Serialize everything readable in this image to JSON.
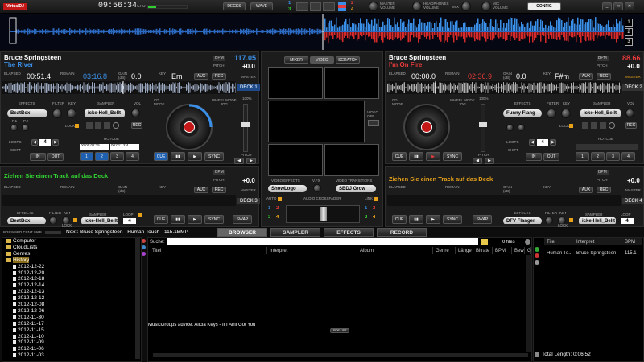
{
  "colors": {
    "accent_blue": "#3a8fe8",
    "accent_red": "#e83a3a",
    "green_text": "#32d232",
    "orange_text": "#e8a21a"
  },
  "topbar": {
    "logo": "VirtualDJ",
    "clock": "09:56:34",
    "cpu_label": "CPU",
    "decks_btn": "DECKS",
    "wave_btn": "WAVE",
    "num_left": [
      "1",
      "3"
    ],
    "num_right": [
      "2",
      "4"
    ],
    "master_volume": "MASTER\nVOLUME",
    "headphones_volume": "HEADPHONES\nVOLUME",
    "mix_label": "MIX",
    "mic_volume": "MIC\nVOLUME",
    "config_btn": "CONFIG"
  },
  "wave_numbers": [
    "1",
    "2",
    "3"
  ],
  "deck1": {
    "artist": "Bruce Springsteen",
    "title": "The River",
    "bpm_badge": "BPM",
    "bpm": "117.05",
    "pitch_label": "PITCH",
    "pitch": "+0.0",
    "elapsed_label": "ELAPSED",
    "elapsed": "00:51.4",
    "remain_label": "REMAIN",
    "remain": "03:16.8",
    "gain_label": "GAIN\n(dB)",
    "gain": "0.0",
    "key_label": "KEY",
    "key": "Em",
    "aux": "AUX",
    "rec": "REC",
    "master": "MASTER",
    "deck_label": "DECK 1",
    "effects_label": "EFFECTS",
    "effect": "BeatBox",
    "p1": "P.1",
    "p2": "P.2",
    "filter_label": "FILTER",
    "key2_label": "KEY",
    "lock_label": "LOCK",
    "sampler_label": "SAMPLER",
    "sampler": "icke-Hell_Bellt",
    "vol_label": "VOL",
    "rec_btn": "REC",
    "cd_mode": "CD\nMODE",
    "wheel_mode": "WHEEL MODE\nJOG",
    "pct": "100%",
    "loops_label": "LOOPS",
    "loop_val": "4",
    "shift": "SHIFT",
    "in_btn": "IN",
    "out_btn": "OUT",
    "hotcue_label": "HOTCUE",
    "hotcue1": "00:00:02:25",
    "hotcue2": "00:01:12:4",
    "cue": "CUE",
    "play": "▮▮",
    "stop": "▶",
    "sync": "SYNC",
    "pads": [
      "1",
      "2",
      "3",
      "4"
    ],
    "pitch_slider_label": "PITCH",
    "nudge_left": "◀",
    "nudge_right": "▶"
  },
  "deck2": {
    "artist": "Bruce Springsteen",
    "title": "I'm On Fire",
    "bpm_badge": "BPM",
    "bpm": "88.66",
    "pitch_label": "PITCH",
    "pitch": "+0.0",
    "elapsed_label": "ELAPSED",
    "elapsed": "00:00.0",
    "remain_label": "REMAIN",
    "remain": "02:36.9",
    "gain_label": "GAIN\n(dB)",
    "gain": "0.0",
    "key_label": "KEY",
    "key": "F#m",
    "aux": "AUX",
    "rec": "REC",
    "master": "MASTER",
    "deck_label": "DECK 2",
    "effects_label": "EFFECTS",
    "effect": "Funny Flang",
    "filter_label": "FILTER",
    "key2_label": "KEY",
    "lock_label": "LOCK",
    "sampler_label": "SAMPLER",
    "sampler": "icke-Hell_Bellt",
    "vol_label": "VOL",
    "rec_btn": "REC",
    "cd_mode": "CD\nMODE",
    "wheel_mode": "WHEEL MODE\nJOG",
    "pct": "100%",
    "loops_label": "LOOPS",
    "loop_val": "4",
    "shift": "SHIFT",
    "in_btn": "IN",
    "out_btn": "OUT",
    "hotcue_label": "HOTCUE",
    "cue": "CUE",
    "play": "▮▮",
    "stop": "▶",
    "sync": "SYNC",
    "pads": [
      "1",
      "2",
      "3",
      "4"
    ],
    "pitch_slider_label": "PITCH",
    "nudge_left": "◀",
    "nudge_right": "▶"
  },
  "center": {
    "mixer": "MIXER",
    "video": "VIDEO",
    "scratch": "SCRATCH",
    "video_effects_label": "VIDEO EFFECTS",
    "video_effect": "ShowLogo",
    "vfx_label": "V.FX",
    "video_transitions_label": "VIDEO TRANSITIONS",
    "video_transition": "SBDJ Grow",
    "auto": "AUTO",
    "link": "LINK",
    "crossfader_label": "AUDIO CROSSFADER",
    "video_off": "VIDEO\nOFF",
    "xf_left": [
      "1",
      "2",
      "3",
      "4"
    ],
    "xf_right": [
      "1",
      "2",
      "3",
      "4"
    ]
  },
  "deck3": {
    "empty_text": "Ziehen Sie einen Track auf das Deck",
    "bpm_badge": "BPM",
    "pitch_label": "PITCH",
    "pitch": "+0.0",
    "elapsed_label": "ELAPSED",
    "remain_label": "REMAIN",
    "gain_label": "GAIN\n(dB)",
    "key_label": "KEY",
    "aux": "AUX",
    "rec": "REC",
    "master": "MASTER",
    "deck_label": "DECK 3",
    "effects_label": "EFFECTS",
    "effect": "BeatBox",
    "filter_label": "FILTER",
    "key2_label": "KEY",
    "lock_label": "LOCK",
    "sampler_label": "SAMPLER",
    "sampler": "icke-Hell_Bellt",
    "loop_label": "LOOP",
    "loop_val": "4",
    "cue": "CUE",
    "play": "▮▮",
    "stop": "▶",
    "sync": "SYNC",
    "swap": "SWAP"
  },
  "deck4": {
    "empty_text": "Ziehen Sie einen Track auf das Deck",
    "bpm_badge": "BPM",
    "pitch_label": "PITCH",
    "pitch": "+0.0",
    "elapsed_label": "ELAPSED",
    "remain_label": "REMAIN",
    "gain_label": "GAIN\n(dB)",
    "key_label": "KEY",
    "aux": "AUX",
    "rec": "REC",
    "master": "MASTER",
    "deck_label": "DECK 4",
    "effects_label": "EFFECTS",
    "effect": "DFV Flanger",
    "filter_label": "FILTER",
    "key2_label": "KEY",
    "lock_label": "LOCK",
    "sampler_label": "SAMPLER",
    "sampler": "icke-Hell_Bellt",
    "loop_label": "LOOP",
    "loop_val": "4",
    "cue": "CUE",
    "play": "▮▮",
    "stop": "▶",
    "sync": "SYNC",
    "swap": "SWAP"
  },
  "browser": {
    "font_size_label": "BROWSER FONT SIZE",
    "next_text": "Next: Bruce Springsteen - Human Touch - 115.1BMP",
    "tabs": [
      "BROWSER",
      "SAMPLER",
      "EFFECTS",
      "RECORD"
    ],
    "search_label": "Suche:",
    "files_count": "0 files",
    "columns": [
      "Titel",
      "Interpret",
      "Album",
      "Genre",
      "Länge",
      "Bitrate",
      "BPM",
      "Bew",
      "G"
    ],
    "tree": [
      {
        "label": "Computer",
        "type": "fold"
      },
      {
        "label": "CloudLists",
        "type": "fold"
      },
      {
        "label": "Genres",
        "type": "fold"
      },
      {
        "label": "History",
        "type": "fold"
      },
      {
        "label": "2012-12-22",
        "type": "doc"
      },
      {
        "label": "2012-12-20",
        "type": "doc"
      },
      {
        "label": "2012-12-18",
        "type": "doc"
      },
      {
        "label": "2012-12-14",
        "type": "doc"
      },
      {
        "label": "2012-12-13",
        "type": "doc"
      },
      {
        "label": "2012-12-12",
        "type": "doc"
      },
      {
        "label": "2012-12-08",
        "type": "doc"
      },
      {
        "label": "2012-12-06",
        "type": "doc"
      },
      {
        "label": "2012-11-30",
        "type": "doc"
      },
      {
        "label": "2012-11-17",
        "type": "doc"
      },
      {
        "label": "2012-11-15",
        "type": "doc"
      },
      {
        "label": "2012-11-10",
        "type": "doc"
      },
      {
        "label": "2012-11-09",
        "type": "doc"
      },
      {
        "label": "2012-11-06",
        "type": "doc"
      },
      {
        "label": "2012-11-03",
        "type": "doc"
      }
    ],
    "advice": "MusicGroups advice: Alicia Keys - If I Aint Got You",
    "side_list": "SIDE LIST",
    "playlist_cols": [
      "Titel",
      "Interpret",
      "BPM"
    ],
    "playlist_row": {
      "title": "Human To...",
      "artist": "Bruce Springsteen",
      "bpm": "115.1"
    },
    "total_length": "Total Length: 0:06:52"
  }
}
